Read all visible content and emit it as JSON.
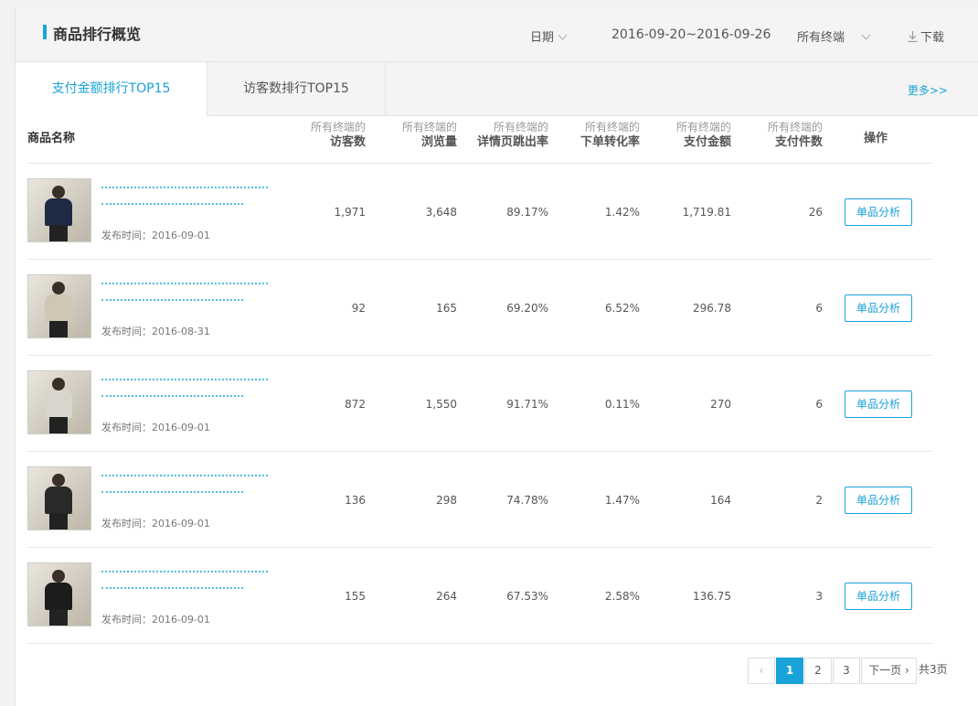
{
  "header": {
    "title": "商品排行概览",
    "date_label": "日期",
    "date_range": "2016-09-20~2016-09-26",
    "terminal": "所有终端",
    "download": "下载"
  },
  "tabs": [
    {
      "label": "支付金额排行TOP15",
      "active": true
    },
    {
      "label": "访客数排行TOP15",
      "active": false
    }
  ],
  "more": "更多>>",
  "columns": {
    "name": "商品名称",
    "prefix": "所有终端的",
    "metrics": [
      "访客数",
      "浏览量",
      "详情页跳出率",
      "下单转化率",
      "支付金额",
      "支付件数"
    ],
    "op": "操作"
  },
  "rows": [
    {
      "pub": "发布时间：2016-09-01",
      "visitors": "1,971",
      "views": "3,648",
      "bounce": "89.17%",
      "conv": "1.42%",
      "amount": "1,719.81",
      "qty": "26",
      "btn": "单品分析",
      "shirt": "#1f2a44"
    },
    {
      "pub": "发布时间：2016-08-31",
      "visitors": "92",
      "views": "165",
      "bounce": "69.20%",
      "conv": "6.52%",
      "amount": "296.78",
      "qty": "6",
      "btn": "单品分析",
      "shirt": "#cfc6b4"
    },
    {
      "pub": "发布时间：2016-09-01",
      "visitors": "872",
      "views": "1,550",
      "bounce": "91.71%",
      "conv": "0.11%",
      "amount": "270",
      "qty": "6",
      "btn": "单品分析",
      "shirt": "#d8d5cc"
    },
    {
      "pub": "发布时间：2016-09-01",
      "visitors": "136",
      "views": "298",
      "bounce": "74.78%",
      "conv": "1.47%",
      "amount": "164",
      "qty": "2",
      "btn": "单品分析",
      "shirt": "#2a2a2a"
    },
    {
      "pub": "发布时间：2016-09-01",
      "visitors": "155",
      "views": "264",
      "bounce": "67.53%",
      "conv": "2.58%",
      "amount": "136.75",
      "qty": "3",
      "btn": "单品分析",
      "shirt": "#1c1c1c"
    }
  ],
  "pagination": {
    "prev": "‹",
    "pages": [
      "1",
      "2",
      "3"
    ],
    "current": "1",
    "next": "下一页 ›",
    "total": "共3页"
  }
}
